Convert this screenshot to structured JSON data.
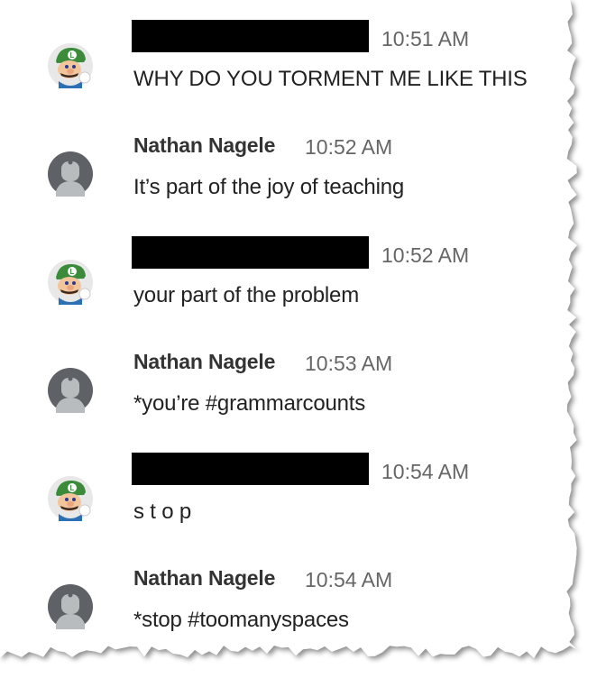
{
  "messages": [
    {
      "sender": "luigi",
      "name": "",
      "redacted": true,
      "time": "10:51 AM",
      "text": "WHY DO YOU TORMENT ME LIKE THIS"
    },
    {
      "sender": "nathan",
      "name": "Nathan Nagele",
      "redacted": false,
      "time": "10:52 AM",
      "text": "It’s part of the joy of teaching"
    },
    {
      "sender": "luigi",
      "name": "",
      "redacted": true,
      "time": "10:52 AM",
      "text": "your part of the problem"
    },
    {
      "sender": "nathan",
      "name": "Nathan Nagele",
      "redacted": false,
      "time": "10:53 AM",
      "text": "*you’re #grammarcounts"
    },
    {
      "sender": "luigi",
      "name": "",
      "redacted": true,
      "time": "10:54 AM",
      "text": "s t o p"
    },
    {
      "sender": "nathan",
      "name": "Nathan Nagele",
      "redacted": false,
      "time": "10:54 AM",
      "text": "*stop #toomanyspaces"
    }
  ],
  "icons": {
    "luigi_avatar": "luigi-avatar-icon",
    "default_avatar": "default-user-avatar-icon"
  },
  "colors": {
    "paper": "#ffffff",
    "text": "#222222",
    "timestamp": "#666666",
    "redaction": "#000000",
    "luigi_green": "#3a8b3a",
    "default_avatar_bg": "#5e6266"
  }
}
